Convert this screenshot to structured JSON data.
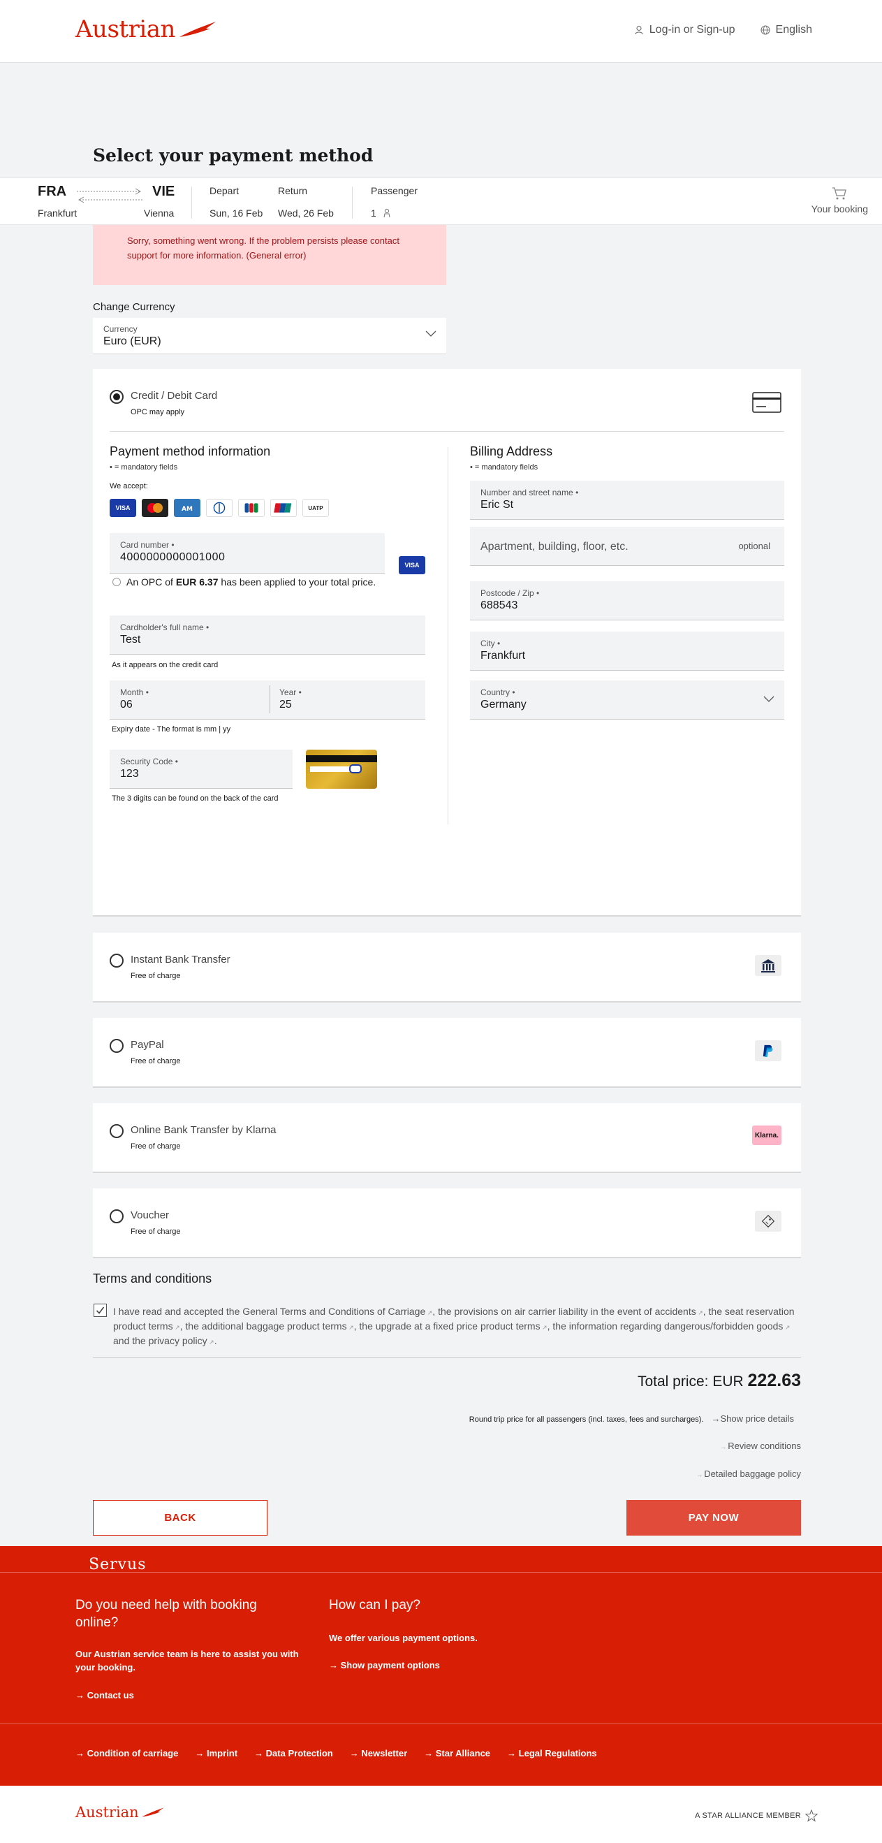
{
  "header": {
    "brand": "Austrian",
    "login": "Log-in or Sign-up",
    "language": "English"
  },
  "page_title": "Select your payment method",
  "booking": {
    "from_code": "FRA",
    "from_city": "Frankfurt",
    "to_code": "VIE",
    "to_city": "Vienna",
    "depart_label": "Depart",
    "depart_date": "Sun, 16 Feb",
    "return_label": "Return",
    "return_date": "Wed, 26 Feb",
    "passenger_label": "Passenger",
    "passenger_count": "1",
    "cart_label": "Your booking"
  },
  "error_message": "Sorry, something went wrong. If the problem persists please contact support for more information. (General error)",
  "currency": {
    "section_label": "Change Currency",
    "field_label": "Currency",
    "value": "Euro (EUR)"
  },
  "card_payment": {
    "title": "Credit / Debit Card",
    "subtitle": "OPC may apply",
    "info_title": "Payment method information",
    "mandatory": "= mandatory fields",
    "we_accept": "We accept:",
    "card_logos": [
      "VISA",
      "MC",
      "AMEX",
      "DINERS",
      "JCB",
      "UNIONPAY",
      "UATP"
    ],
    "card_number_label": "Card number",
    "card_number": "4000000000001000",
    "detected_brand": "VISA",
    "opc_prefix": "An OPC of",
    "opc_amount": "EUR 6.37",
    "opc_suffix": "has been applied to your total price.",
    "holder_label": "Cardholder's full name",
    "holder_value": "Test",
    "holder_hint": "As it appears on the credit card",
    "month_label": "Month",
    "month_value": "06",
    "year_label": "Year",
    "year_value": "25",
    "expiry_hint": "Expiry date - The format is mm | yy",
    "cvc_label": "Security Code",
    "cvc_value": "123",
    "cvc_hint": "The 3 digits can be found on the back of the card"
  },
  "billing": {
    "title": "Billing Address",
    "mandatory": "= mandatory fields",
    "street_label": "Number and street name",
    "street_value": "Eric St",
    "apartment_placeholder": "Apartment, building, floor, etc.",
    "optional": "optional",
    "postcode_label": "Postcode / Zip",
    "postcode_value": "688543",
    "city_label": "City",
    "city_value": "Frankfurt",
    "country_label": "Country",
    "country_value": "Germany"
  },
  "other_methods": [
    {
      "title": "Instant Bank Transfer",
      "subtitle": "Free of charge",
      "icon": "bank-icon"
    },
    {
      "title": "PayPal",
      "subtitle": "Free of charge",
      "icon": "paypal-icon"
    },
    {
      "title": "Online Bank Transfer by Klarna",
      "subtitle": "Free of charge",
      "icon": "klarna-icon",
      "badge": "Klarna."
    },
    {
      "title": "Voucher",
      "subtitle": "Free of charge",
      "icon": "voucher-icon"
    }
  ],
  "terms": {
    "title": "Terms and conditions",
    "t1": "I have read and accepted the",
    "l1": "General Terms and Conditions of Carriage",
    "t2": ", the",
    "l2": "provisions on air carrier liability in the event of accidents",
    "t3": ", the",
    "l3": "seat reservation product terms",
    "t4": ", the",
    "l4": "additional baggage product terms",
    "t5": ", the",
    "l5": "upgrade at a fixed price product terms",
    "t6": ", the",
    "l6": "information regarding dangerous/forbidden goods",
    "t7": "and the",
    "l7": "privacy policy",
    "t8": "."
  },
  "price": {
    "label": "Total price: EUR",
    "amount": "222.63",
    "note": "Round trip price for all passengers (incl. taxes, fees and surcharges).",
    "show_details": "Show price details",
    "review": "Review conditions",
    "baggage": "Detailed baggage policy"
  },
  "buttons": {
    "back": "BACK",
    "pay": "PAY NOW"
  },
  "footer": {
    "servus": "Servus",
    "help_title": "Do you need help with booking online?",
    "help_text": "Our Austrian service team is here to assist you with your booking.",
    "contact": "Contact us",
    "pay_title": "How can I pay?",
    "pay_text": "We offer various payment options.",
    "pay_link": "Show payment options",
    "links": [
      "Condition of carriage",
      "Imprint",
      "Data Protection",
      "Newsletter",
      "Star Alliance",
      "Legal Regulations"
    ],
    "brand": "Austrian",
    "star_alliance": "A STAR ALLIANCE MEMBER"
  },
  "colors": {
    "brand_red": "#d81e05",
    "pay_button": "#e14b3a",
    "error_bg": "#ffd7d9"
  }
}
